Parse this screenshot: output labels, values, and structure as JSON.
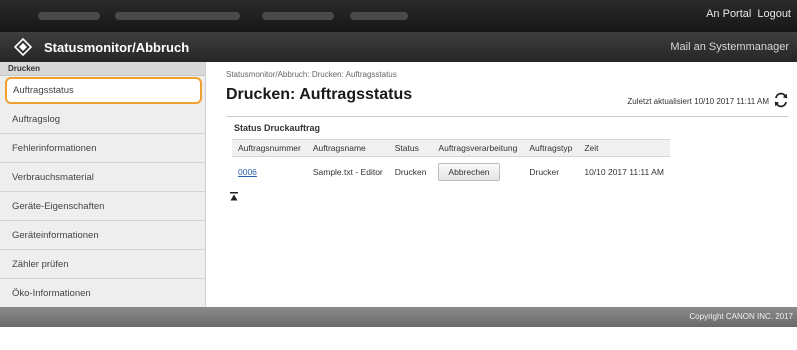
{
  "topbar": {
    "links": [
      "An Portal",
      "Logout"
    ]
  },
  "header": {
    "app_title": "Statusmonitor/Abbruch",
    "mail_link": "Mail an Systemmanager"
  },
  "sidebar": {
    "section_label": "Drucken",
    "items": [
      {
        "label": "Auftragsstatus",
        "active": true
      },
      {
        "label": "Auftragslog"
      },
      {
        "label": "Fehlerinformationen"
      },
      {
        "label": "Verbrauchsmaterial"
      },
      {
        "label": "Geräte-Eigenschaften"
      },
      {
        "label": "Geräteinformationen"
      },
      {
        "label": "Zähler prüfen"
      },
      {
        "label": "Öko-Informationen"
      }
    ]
  },
  "main": {
    "breadcrumb": "Statusmonitor/Abbruch: Drucken: Auftragsstatus",
    "title": "Drucken: Auftragsstatus",
    "last_updated": "Zuletzt aktualisiert 10/10 2017 11:11 AM",
    "panel_title": "Status Druckauftrag",
    "table": {
      "headers": [
        "Auftragsnummer",
        "Auftragsname",
        "Status",
        "Auftragsverarbeitung",
        "Auftragstyp",
        "Zeit"
      ],
      "rows": [
        {
          "number": "0006",
          "name": "Sample.txt - Editor",
          "status": "Drucken",
          "action": "Abbrechen",
          "type": "Drucker",
          "time": "10/10 2017 11:11 AM"
        }
      ]
    }
  },
  "footer": {
    "copyright": "Copyright CANON INC. 2017"
  },
  "colors": {
    "active_outline": "#f0a030",
    "link": "#2a5db0",
    "header_bg": "#262626"
  },
  "icons": {
    "logo": "canon-diamond-icon",
    "refresh": "refresh-icon",
    "scroll_top": "scroll-to-top-icon"
  }
}
